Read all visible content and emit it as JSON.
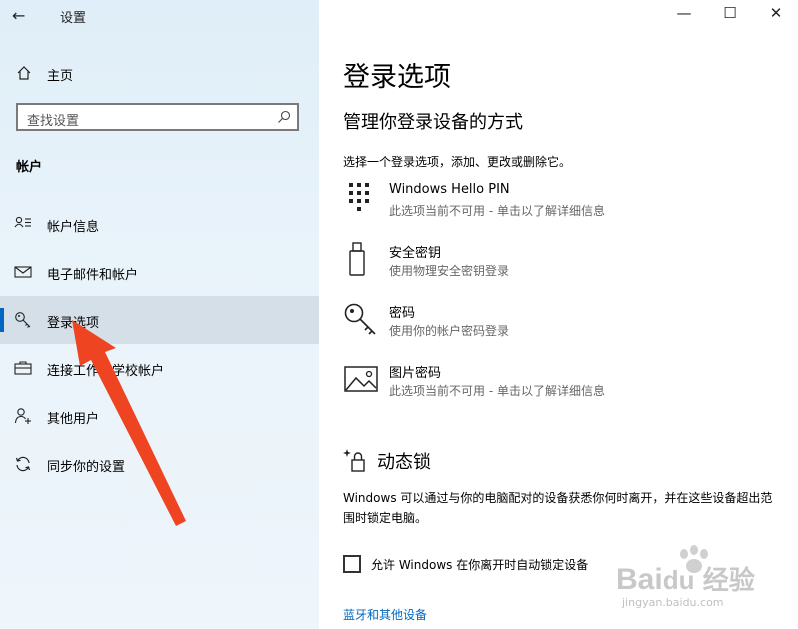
{
  "window": {
    "title": "设置"
  },
  "sidebar": {
    "home": "主页",
    "search_placeholder": "查找设置",
    "section": "帐户",
    "items": [
      {
        "label": "帐户信息"
      },
      {
        "label": "电子邮件和帐户"
      },
      {
        "label": "登录选项"
      },
      {
        "label": "连接工作或学校帐户"
      },
      {
        "label": "其他用户"
      },
      {
        "label": "同步你的设置"
      }
    ]
  },
  "main": {
    "title": "登录选项",
    "subtitle": "管理你登录设备的方式",
    "description": "选择一个登录选项，添加、更改或删除它。",
    "options": [
      {
        "title": "Windows Hello PIN",
        "subtitle": "此选项当前不可用 - 单击以了解详细信息",
        "icon": "pin-keypad-icon"
      },
      {
        "title": "安全密钥",
        "subtitle": "使用物理安全密钥登录",
        "icon": "usb-key-icon"
      },
      {
        "title": "密码",
        "subtitle": "使用你的帐户密码登录",
        "icon": "key-icon"
      },
      {
        "title": "图片密码",
        "subtitle": "此选项当前不可用 - 单击以了解详细信息",
        "icon": "picture-icon"
      }
    ],
    "dynamic_lock": {
      "title": "动态锁",
      "description": "Windows 可以通过与你的电脑配对的设备获悉你何时离开，并在这些设备超出范围时锁定电脑。",
      "checkbox_label": "允许 Windows 在你离开时自动锁定设备",
      "link": "蓝牙和其他设备"
    }
  },
  "watermark": {
    "brand": "Bai",
    "brand2": "du",
    "cn": "经验",
    "url": "jingyan.baidu.com"
  },
  "colors": {
    "accent": "#0067c0",
    "arrow": "#ee4422",
    "sidebar_bg": "#e6f1f9"
  }
}
